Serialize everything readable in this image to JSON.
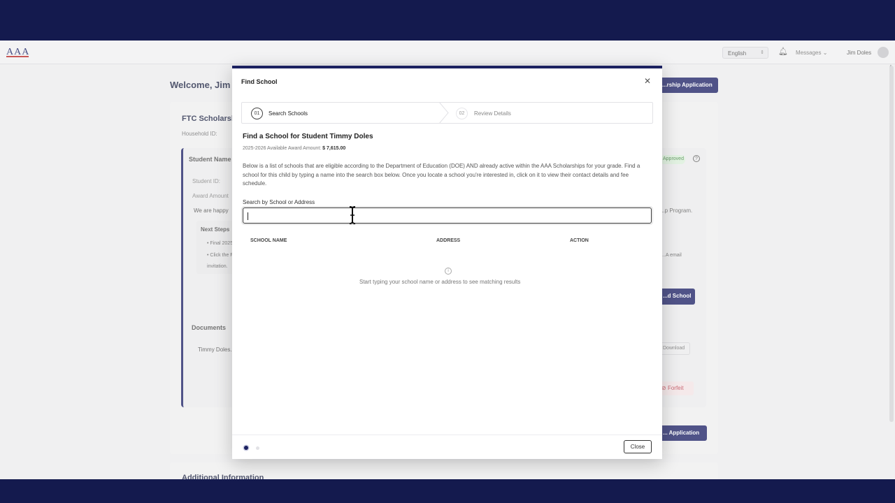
{
  "app": {
    "logo": "AAA",
    "language": "English",
    "messages": "Messages",
    "user_name": "Jim Doles"
  },
  "dashboard": {
    "welcome": "Welcome, Jim",
    "start_app_button": "...rship Application",
    "card_title": "FTC Scholarsh...",
    "household_label": "Household ID:",
    "student_name_label": "Student Name",
    "student_id_label": "Student ID:",
    "award_amount_label": "Award Amount",
    "happy_text": "We are happy",
    "program_text": "...p Program.",
    "next_steps": "Next Steps",
    "next_step_1": "Final 2025...",
    "next_step_2": "Click the F...",
    "next_step_3": "invitation.",
    "email_text": "...A email",
    "status_badge": "Approved",
    "find_school_button": "...d School",
    "documents_heading": "Documents",
    "document_name": "Timmy Doles...",
    "download_button": "Download",
    "forfeit_button": "Forfeit",
    "submit_app_button": "... Application",
    "additional_info": "Additional Information"
  },
  "modal": {
    "title": "Find School",
    "steps": [
      {
        "number": "01",
        "label": "Search Schools"
      },
      {
        "number": "02",
        "label": "Review Details"
      }
    ],
    "heading": "Find a School for Student Timmy Doles",
    "award_label": "2025-2026 Available Award Amount:",
    "award_value": "$ 7,615.00",
    "description": "Below is a list of schools that are eligible according to the Department of Education (DOE) AND already active within the AAA Scholarships for your grade. Find a school for this child by typing a name into the search box below. Once you locate a school you're interested in, click on it to view their contact details and fee schedule.",
    "search_label": "Search by School or Address",
    "search_value": "",
    "columns": [
      "SCHOOL NAME",
      "ADDRESS",
      "ACTION"
    ],
    "empty_message": "Start typing your school name or address to see matching results",
    "close_button": "Close",
    "current_step": 1,
    "total_steps": 2
  },
  "colors": {
    "navy": "#1c2160",
    "band": "#141a4e",
    "forfeit": "#c04a57"
  }
}
